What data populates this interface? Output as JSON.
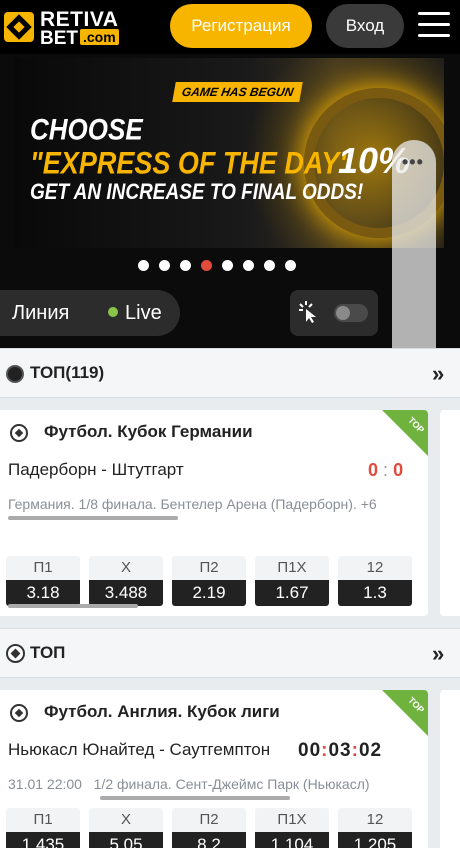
{
  "header": {
    "logo_top": "RETIVA",
    "logo_bottom": "BET",
    "logo_com": ".com",
    "register_label": "Регистрация",
    "login_label": "Вход"
  },
  "banner": {
    "tag": "GAME HAS BEGUN",
    "line1": "CHOOSE",
    "line2": "\"EXPRESS OF THE DAY\"",
    "line3": "GET AN INCREASE TO FINAL ODDS!",
    "percent": "10%",
    "dots_count": 8,
    "active_dot": 3
  },
  "tabs": {
    "line_label": "Линия",
    "live_label": "Live"
  },
  "sections": [
    {
      "title": "ТОП(119)"
    },
    {
      "title": "ТОП"
    }
  ],
  "events": [
    {
      "league": "Футбол. Кубок Германии",
      "badge": "TOP",
      "teams": "Падерборн - Штутгарт",
      "score_home": "0",
      "score_away": "0",
      "sub": "Германия. 1/8 финала. Бентелер Арена (Падерборн). +6",
      "odds": [
        {
          "label": "П1",
          "value": "3.18"
        },
        {
          "label": "Х",
          "value": "3.488"
        },
        {
          "label": "П2",
          "value": "2.19"
        },
        {
          "label": "П1Х",
          "value": "1.67"
        },
        {
          "label": "12",
          "value": "1.3"
        }
      ]
    },
    {
      "league": "Футбол. Англия. Кубок лиги",
      "badge": "TOP",
      "teams": "Ньюкасл Юнайтед - Саутгемптон",
      "timer_h": "00",
      "timer_m": "03",
      "timer_s": "02",
      "datetime": "31.01 22:00",
      "sub": "1/2 финала. Сент-Джеймс Парк (Ньюкасл)",
      "odds": [
        {
          "label": "П1",
          "value": "1.435"
        },
        {
          "label": "Х",
          "value": "5.05"
        },
        {
          "label": "П2",
          "value": "8.2"
        },
        {
          "label": "П1Х",
          "value": "1.104"
        },
        {
          "label": "12",
          "value": "1.205"
        }
      ]
    }
  ],
  "colors": {
    "accent": "#f7b500",
    "live": "#8bc34a",
    "score": "#e14b3b",
    "top_badge": "#6fb23e"
  }
}
